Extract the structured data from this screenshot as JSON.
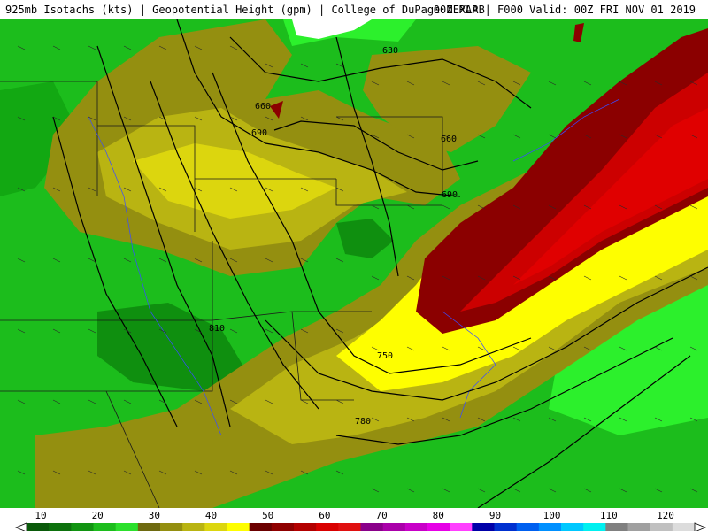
{
  "header": {
    "left_text": "925mb Isotachs (kts) | Geopotential Height (gpm) | College of DuPage NEXLAB",
    "right_text": "00Z RAP | F000 Valid: 00Z FRI NOV 01 2019"
  },
  "contour_labels": [
    {
      "text": "630"
    },
    {
      "text": "660"
    },
    {
      "text": "690"
    },
    {
      "text": "660"
    },
    {
      "text": "690"
    },
    {
      "text": "810"
    },
    {
      "text": "750"
    },
    {
      "text": "780"
    }
  ],
  "colorbar": {
    "tick_labels": [
      "10",
      "20",
      "30",
      "40",
      "50",
      "60",
      "70",
      "80",
      "90",
      "100",
      "110",
      "120"
    ],
    "colors": [
      "#0a5a0a",
      "#0d720d",
      "#119411",
      "#1cbd1c",
      "#2ce02c",
      "#6e6a10",
      "#948f10",
      "#b9b412",
      "#dcd60e",
      "#fefe00",
      "#6b0000",
      "#8f0000",
      "#b30000",
      "#d90000",
      "#e01010",
      "#8a008a",
      "#aa00aa",
      "#c800c8",
      "#e600e6",
      "#ff40ff",
      "#0000a8",
      "#0030d0",
      "#0060f0",
      "#0090ff",
      "#00c8ff",
      "#00f0f0",
      "#808080",
      "#a0a0a0",
      "#c0c0c0",
      "#dcdcdc"
    ]
  },
  "legend_colors": {
    "green_dark": "#0f7a0f",
    "green": "#12b412",
    "green_bright": "#2cf02c",
    "olive_dark": "#6e6a10",
    "olive": "#948f10",
    "yellow_dark": "#c9c40f",
    "yellow": "#fefe00",
    "red_dark": "#8b0000",
    "red": "#cc0000",
    "red_bright": "#e00000"
  }
}
